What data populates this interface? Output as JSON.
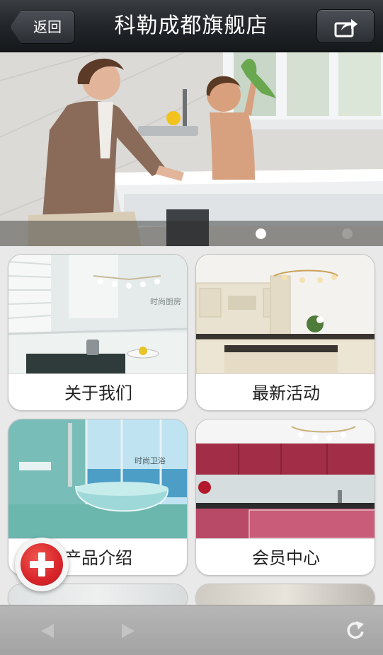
{
  "header": {
    "back_label": "返回",
    "title": "科勒成都旗舰店",
    "share_icon": "share-icon"
  },
  "banner": {
    "total_slides": 2,
    "active_slide": 1
  },
  "grid": {
    "items": [
      {
        "label": "关于我们",
        "icon": "kitchen-photo"
      },
      {
        "label": "最新活动",
        "icon": "cabinet-photo"
      },
      {
        "label": "产品介绍",
        "icon": "bathroom-photo"
      },
      {
        "label": "会员中心",
        "icon": "red-kitchen-photo"
      }
    ]
  },
  "fab": {
    "icon": "plus-icon"
  },
  "toolbar": {
    "icons": [
      "back-arrow-icon",
      "forward-arrow-icon",
      "refresh-icon"
    ]
  },
  "colors": {
    "topbar": "#24272b",
    "fab": "#d8242a",
    "toolbar": "#ababab"
  }
}
